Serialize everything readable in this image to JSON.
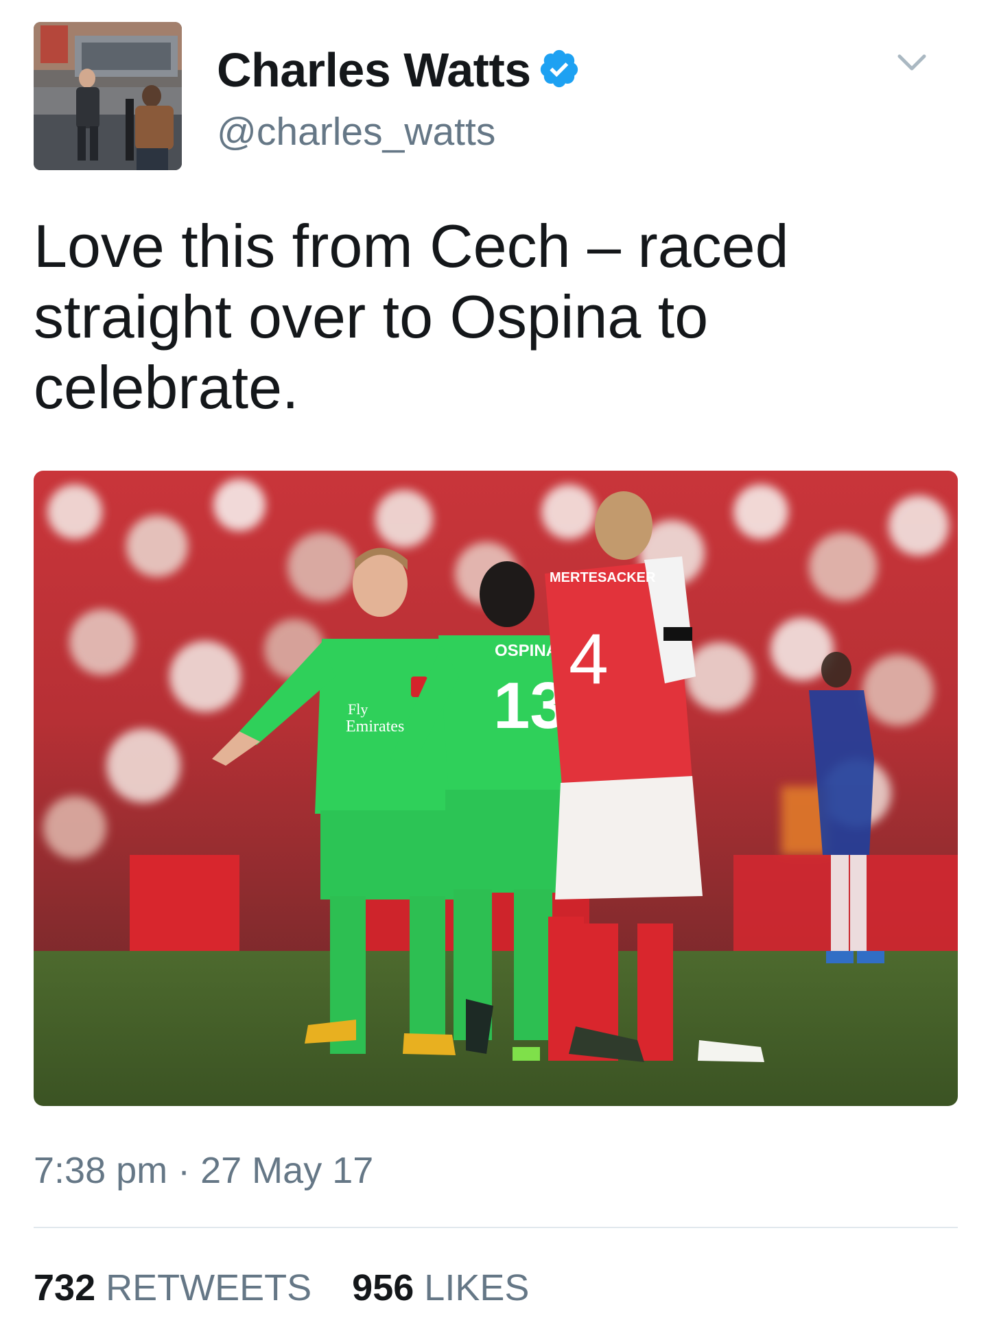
{
  "tweet": {
    "author": {
      "display_name": "Charles Watts",
      "handle": "@charles_watts",
      "verified": true
    },
    "text": "Love this from Cech – raced straight over to Ospina to celebrate.",
    "timestamp": "7:38 pm · 27 May 17",
    "stats": {
      "retweets_count": "732",
      "retweets_label": "RETWEETS",
      "likes_count": "956",
      "likes_label": "LIKES"
    },
    "media": {
      "jersey_text_1": "OSPINA",
      "jersey_number_1": "13",
      "jersey_text_2": "MERTESACKER",
      "jersey_number_2": "4",
      "shirt_sponsor": "Fly Emirates"
    }
  },
  "icons": {
    "verified": "verified-badge-icon",
    "menu": "chevron-down-icon"
  },
  "colors": {
    "text_primary": "#14171a",
    "text_secondary": "#657786",
    "verified_blue": "#1da1f2",
    "divider": "#e1e8ed"
  }
}
